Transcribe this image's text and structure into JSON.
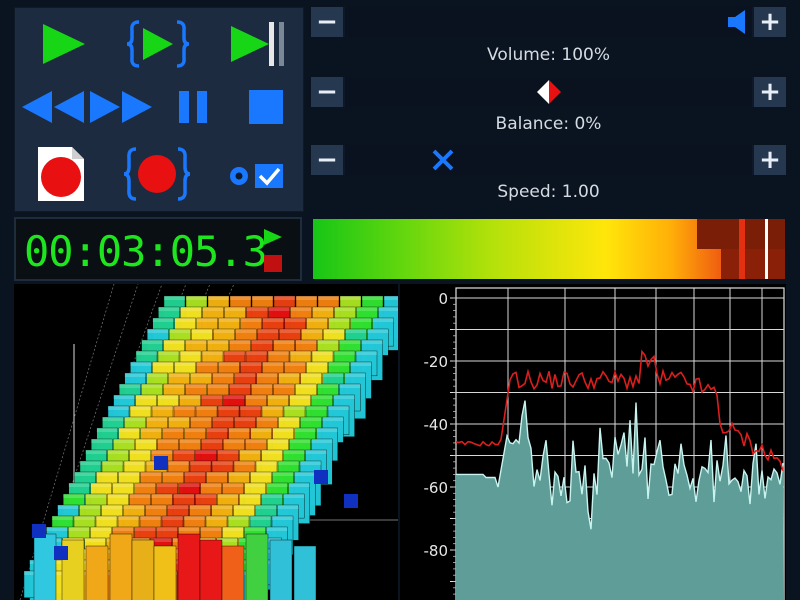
{
  "transport": {
    "play_icon": "play-icon",
    "play_loop_icon": "play-loop-icon",
    "play_to_end_icon": "play-to-end-icon",
    "rewind_icon": "rewind-icon",
    "fast_forward_icon": "fast-forward-icon",
    "pause_icon": "pause-icon",
    "stop_icon": "stop-icon",
    "record_file_icon": "record-file-icon",
    "record_loop_icon": "record-loop-icon",
    "monitor_icon": "monitor-check-icon"
  },
  "sliders": {
    "volume": {
      "label": "Volume: 100%",
      "value": 1.0,
      "minus": "−",
      "plus": "+"
    },
    "balance": {
      "label": "Balance: 0%",
      "value": 0.5,
      "minus": "−",
      "plus": "+"
    },
    "speed": {
      "label": "Speed: 1.00",
      "value": 0.22,
      "minus": "−",
      "plus": "+"
    }
  },
  "time": {
    "display": "00:03:05.3"
  },
  "spectrum": {
    "y_ticks": [
      "0",
      "-20",
      "-40",
      "-60",
      "-80"
    ]
  },
  "colors": {
    "panel": "#1c2b40",
    "play_green": "#16d616",
    "transport_blue": "#1a78ff",
    "record_red": "#e81010",
    "time_green": "#1ee61e",
    "spectrum_fill": "#5f9d98",
    "spectrum_peak_line": "#dc1e1e"
  }
}
